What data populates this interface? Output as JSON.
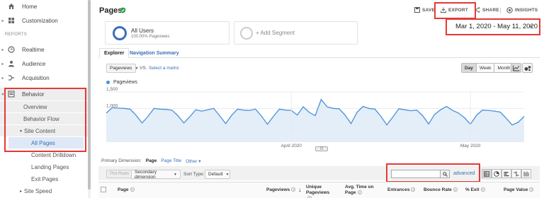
{
  "sidebar": {
    "home": "Home",
    "customization": "Customization",
    "reports_section": "REPORTS",
    "realtime": "Realtime",
    "audience": "Audience",
    "acquisition": "Acquisition",
    "behavior": "Behavior",
    "overview": "Overview",
    "behavior_flow": "Behavior Flow",
    "site_content": "Site Content",
    "all_pages": "All Pages",
    "content_drilldown": "Content Drilldown",
    "landing_pages": "Landing Pages",
    "exit_pages": "Exit Pages",
    "site_speed": "Site Speed"
  },
  "header": {
    "title": "Pages",
    "save": "SAVE",
    "export": "EXPORT",
    "share": "SHARE",
    "insights": "INSIGHTS"
  },
  "segments": {
    "all_users": "All Users",
    "all_users_sub": "100.00% Pageviews",
    "add_segment": "+ Add Segment"
  },
  "date_range": "Mar 1, 2020 - May 11, 2020",
  "tabs": [
    "Explorer",
    "Navigation Summary"
  ],
  "chart_controls": {
    "metric": "Pageviews",
    "vs": "VS.",
    "select_metric": "Select a metric",
    "granularity": [
      "Day",
      "Week",
      "Month"
    ],
    "selected_granularity": "Day"
  },
  "chart_data": {
    "type": "area",
    "legend": [
      "Pageviews"
    ],
    "yticks": [
      "1,500",
      "1,000",
      "500"
    ],
    "ylim": [
      0,
      1500
    ],
    "xticks": [
      "April 2020",
      "May 2020"
    ],
    "color": "#4a90d9",
    "values": [
      860,
      1020,
      1010,
      1000,
      980,
      790,
      560,
      760,
      1000,
      980,
      970,
      950,
      780,
      560,
      750,
      960,
      920,
      960,
      1000,
      780,
      540,
      790,
      980,
      950,
      940,
      980,
      770,
      520,
      760,
      980,
      950,
      940,
      800,
      1050,
      880,
      780,
      1270,
      1050,
      1000,
      990,
      800,
      540,
      880,
      1060,
      1000,
      980,
      760,
      500,
      740,
      990,
      960,
      930,
      950,
      780,
      530,
      820,
      960,
      1060,
      940,
      860,
      720,
      520,
      790,
      950,
      940,
      920,
      890,
      700,
      500,
      580,
      760
    ]
  },
  "primary_dimension": {
    "label": "Primary Dimension:",
    "current": "Page",
    "page_title": "Page Title",
    "other": "Other"
  },
  "table_toolbar": {
    "plot_rows": "Plot Rows",
    "secondary_dimension": "Secondary dimension",
    "sort_type_label": "Sort Type:",
    "sort_type_value": "Default",
    "advanced": "advanced"
  },
  "table_headers": {
    "page": "Page",
    "pageviews": "Pageviews",
    "unique_pageviews": "Unique Pageviews",
    "avg_time": "Avg. Time on Page",
    "entrances": "Entrances",
    "bounce_rate": "Bounce Rate",
    "exit": "% Exit",
    "page_value": "Page Value"
  },
  "colors": {
    "accent": "#3b6fb6",
    "highlight": "#e53935",
    "verified": "#2e9e4f"
  }
}
